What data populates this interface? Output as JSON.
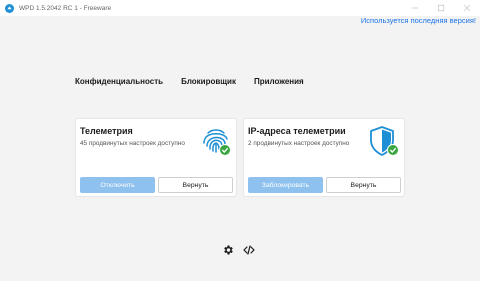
{
  "window": {
    "title": "WPD 1.5.2042 RC 1 - Freeware",
    "icon": "wpd-app-icon"
  },
  "header": {
    "update_link": "Используется последняя версия!"
  },
  "tabs": [
    {
      "label": "Конфиденциальность"
    },
    {
      "label": "Блокировщик"
    },
    {
      "label": "Приложения"
    }
  ],
  "cards": [
    {
      "title": "Телеметрия",
      "subtitle": "45 продвинутых настроек доступно",
      "icon": "fingerprint-check-icon",
      "primary_button": "Отключить",
      "secondary_button": "Вернуть"
    },
    {
      "title": "IP-адреса телеметрии",
      "subtitle": "2 продвинутых настроек доступно",
      "icon": "shield-check-icon",
      "primary_button": "Заблокировать",
      "secondary_button": "Вернуть"
    }
  ],
  "footer": {
    "icons": [
      "gear-icon",
      "code-icon"
    ]
  },
  "colors": {
    "accent": "#1e8fd5",
    "link": "#1a73e8",
    "primary_button": "#8ec1ee",
    "check": "#3aa640"
  }
}
